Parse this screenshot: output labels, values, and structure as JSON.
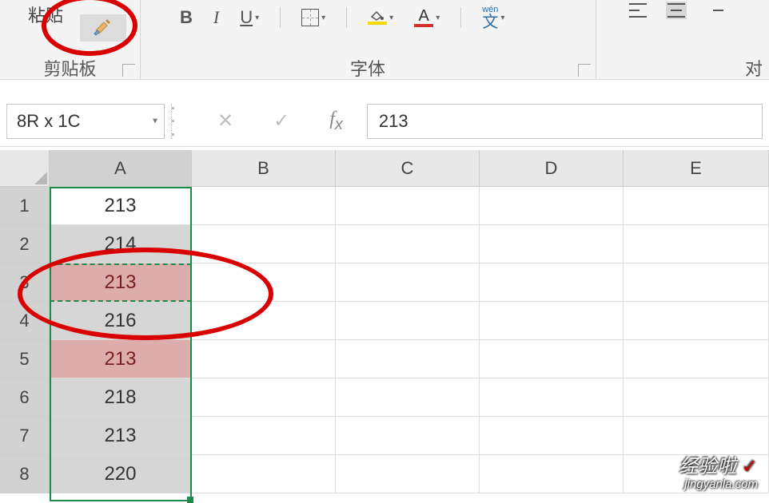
{
  "ribbon": {
    "clipboard": {
      "paste": "粘贴",
      "label": "剪贴板"
    },
    "font": {
      "label": "字体",
      "bold": "B",
      "italic": "I",
      "underline": "U",
      "fontcolor_a": "A",
      "wen_top": "wén",
      "wen_bot": "文"
    },
    "align": {
      "label": "对"
    }
  },
  "namebox": "8R x 1C",
  "formula_value": "213",
  "columns": [
    "A",
    "B",
    "C",
    "D",
    "E"
  ],
  "rows": [
    "1",
    "2",
    "3",
    "4",
    "5",
    "6",
    "7",
    "8"
  ],
  "cellsA": [
    "213",
    "214",
    "213",
    "216",
    "213",
    "218",
    "213",
    "220"
  ],
  "watermark": {
    "top": "经验啦",
    "check": "✓",
    "bottom": "jingyanla.com"
  }
}
